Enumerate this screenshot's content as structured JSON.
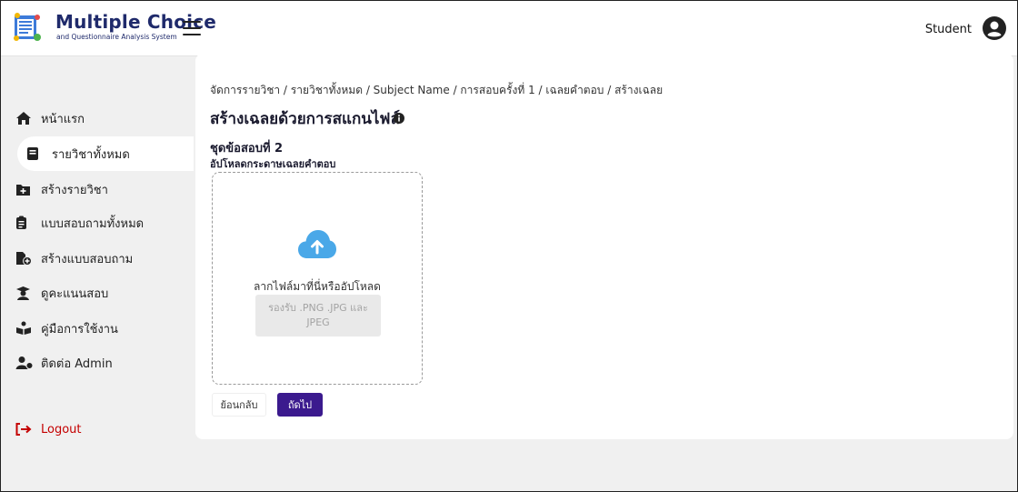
{
  "header": {
    "title": "Multiple Choice",
    "subtitle": "and Questionnaire Analysis System",
    "user_name": "Student"
  },
  "sidebar": {
    "items": [
      {
        "label": "หน้าแรก",
        "icon": "home-icon"
      },
      {
        "label": "รายวิชาทั้งหมด",
        "icon": "book-icon",
        "active": true
      },
      {
        "label": "สร้างรายวิชา",
        "icon": "add-folder-icon"
      },
      {
        "label": "แบบสอบถามทั้งหมด",
        "icon": "clipboard-icon"
      },
      {
        "label": "สร้างแบบสอบถาม",
        "icon": "add-file-icon"
      },
      {
        "label": "ดูคะแนนสอบ",
        "icon": "graduate-icon"
      },
      {
        "label": "คู่มือการใช้งาน",
        "icon": "reading-icon"
      },
      {
        "label": "ติดต่อ Admin",
        "icon": "contact-user-icon"
      }
    ],
    "logout_label": "Logout"
  },
  "main": {
    "breadcrumb": "จัดการรายวิชา / รายวิชาทั้งหมด / Subject Name / การสอบครั้งที่ 1 / เฉลยคำตอบ / สร้างเฉลย",
    "page_title": "สร้างเฉลยด้วยการสแกนไฟล์",
    "set_title": "ชุดข้อสอบที่ 2",
    "upload_label": "อัปโหลดกระดาษเฉลยคำตอบ",
    "dropzone": {
      "text": "ลากไฟล์มาที่นี่หรืออัปโหลด",
      "accepted_line1": "รองรับ .PNG .JPG และ",
      "accepted_line2": "JPEG"
    },
    "back_label": "ย้อนกลับ",
    "next_label": "ถัดไป"
  },
  "colors": {
    "primary_button": "#3b1a8e",
    "logout": "#c40000",
    "upload_cloud": "#4aa8e8",
    "brand": "#1f2a6b"
  }
}
